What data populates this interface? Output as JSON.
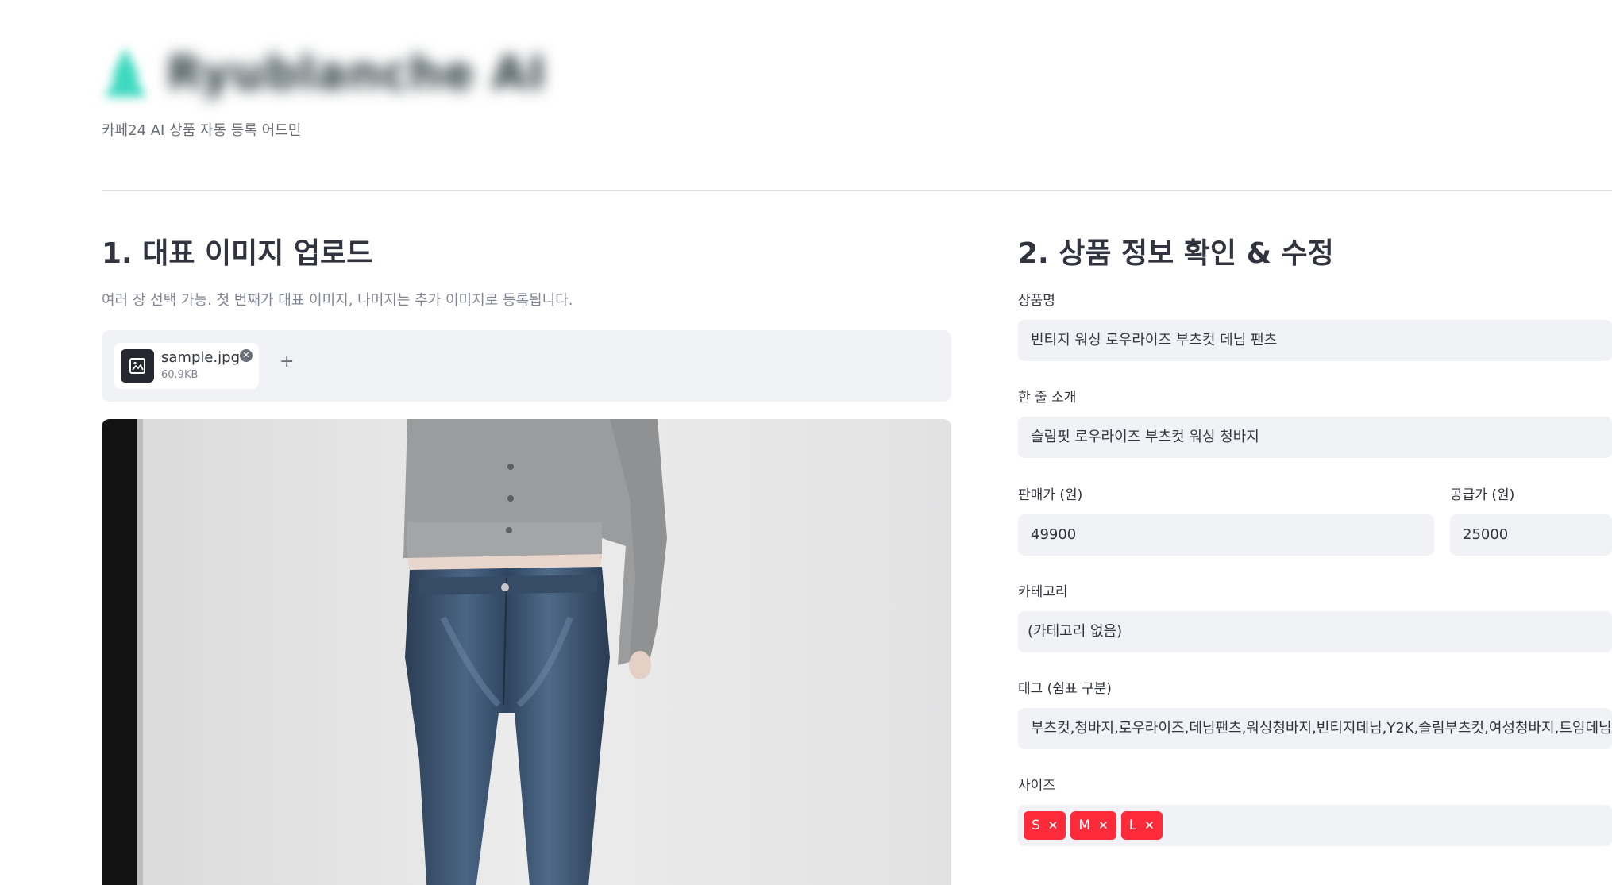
{
  "header": {
    "app_title": "Ryublanche AI",
    "subtitle": "카페24 AI 상품 자동 등록 어드민",
    "logo_color": "#3dd9c0"
  },
  "upload_section": {
    "title": "1. 대표 이미지 업로드",
    "caption": "여러 장 선택 가능. 첫 번째가 대표 이미지, 나머지는 추가 이미지로 등록됩니다.",
    "file": {
      "name": "sample.jpg",
      "size": "60.9KB",
      "icon": "image-icon"
    },
    "remove_icon": "close-circle-icon",
    "add_label": "+"
  },
  "product_section": {
    "title": "2. 상품 정보 확인 & 수정",
    "fields": {
      "name": {
        "label": "상품명",
        "value": "빈티지 워싱 로우라이즈 부츠컷 데님 팬츠"
      },
      "summary": {
        "label": "한 줄 소개",
        "value": "슬림핏 로우라이즈 부츠컷 워싱 청바지"
      },
      "price": {
        "label": "판매가 (원)",
        "value": "49900"
      },
      "supply_price": {
        "label": "공급가 (원)",
        "value": "25000"
      },
      "category": {
        "label": "카테고리",
        "value": "(카테고리 없음)"
      },
      "tags": {
        "label": "태그 (쉼표 구분)",
        "value": "부츠컷,청바지,로우라이즈,데님팬츠,워싱청바지,빈티지데님,Y2K,슬림부츠컷,여성청바지,트임데님,데'"
      },
      "sizes": {
        "label": "사이즈",
        "options": [
          "S",
          "M",
          "L"
        ],
        "tag_color": "#ff2b3b"
      }
    }
  }
}
